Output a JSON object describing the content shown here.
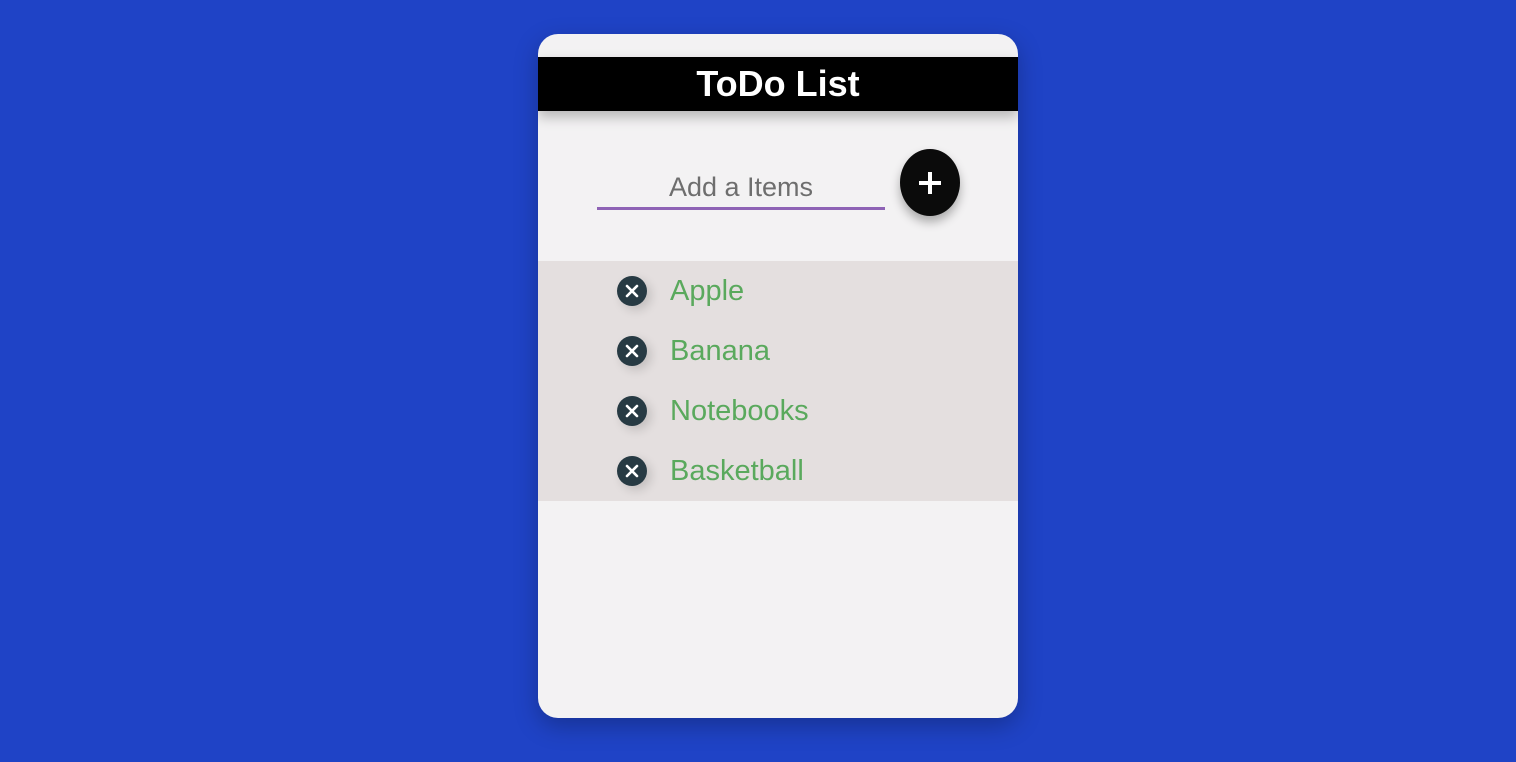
{
  "app": {
    "title": "ToDo List"
  },
  "add_form": {
    "placeholder": "Add a Items",
    "value": "",
    "button_icon": "plus-icon"
  },
  "items": [
    {
      "label": "Apple",
      "remove_icon": "close-icon"
    },
    {
      "label": "Banana",
      "remove_icon": "close-icon"
    },
    {
      "label": "Notebooks",
      "remove_icon": "close-icon"
    },
    {
      "label": "Basketball",
      "remove_icon": "close-icon"
    }
  ],
  "colors": {
    "background": "#1f43c6",
    "card": "#f3f2f3",
    "header": "#000000",
    "list_background": "#e4dfdf",
    "item_text": "#5aa95d",
    "remove_button": "#273a43",
    "input_underline": "#8e63b5"
  }
}
